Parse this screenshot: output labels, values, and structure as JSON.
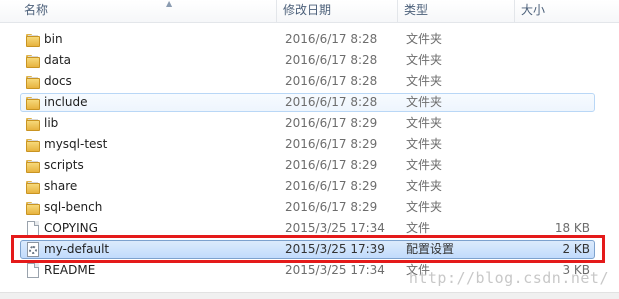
{
  "columns": {
    "name": "名称",
    "date": "修改日期",
    "type": "类型",
    "size": "大小"
  },
  "files": [
    {
      "name": "bin",
      "date": "2016/6/17 8:28",
      "type": "文件夹",
      "size": "",
      "icon": "folder-icon",
      "state": ""
    },
    {
      "name": "data",
      "date": "2016/6/17 8:28",
      "type": "文件夹",
      "size": "",
      "icon": "folder-icon",
      "state": ""
    },
    {
      "name": "docs",
      "date": "2016/6/17 8:28",
      "type": "文件夹",
      "size": "",
      "icon": "folder-icon",
      "state": ""
    },
    {
      "name": "include",
      "date": "2016/6/17 8:28",
      "type": "文件夹",
      "size": "",
      "icon": "folder-icon",
      "state": "hover"
    },
    {
      "name": "lib",
      "date": "2016/6/17 8:29",
      "type": "文件夹",
      "size": "",
      "icon": "folder-icon",
      "state": ""
    },
    {
      "name": "mysql-test",
      "date": "2016/6/17 8:29",
      "type": "文件夹",
      "size": "",
      "icon": "folder-icon",
      "state": ""
    },
    {
      "name": "scripts",
      "date": "2016/6/17 8:29",
      "type": "文件夹",
      "size": "",
      "icon": "folder-icon",
      "state": ""
    },
    {
      "name": "share",
      "date": "2016/6/17 8:29",
      "type": "文件夹",
      "size": "",
      "icon": "folder-icon",
      "state": ""
    },
    {
      "name": "sql-bench",
      "date": "2016/6/17 8:29",
      "type": "文件夹",
      "size": "",
      "icon": "folder-icon",
      "state": ""
    },
    {
      "name": "COPYING",
      "date": "2015/3/25 17:34",
      "type": "文件",
      "size": "18 KB",
      "icon": "file-icon",
      "state": ""
    },
    {
      "name": "my-default",
      "date": "2015/3/25 17:39",
      "type": "配置设置",
      "size": "2 KB",
      "icon": "config-file-icon",
      "state": "selected"
    },
    {
      "name": "README",
      "date": "2015/3/25 17:34",
      "type": "文件",
      "size": "3 KB",
      "icon": "file-icon",
      "state": ""
    }
  ],
  "watermark": "http://blog.csdn.net/",
  "colors": {
    "annotation": "#e41a1a",
    "selection": "#c1dbfc",
    "hover_border": "#b9d7f6"
  }
}
